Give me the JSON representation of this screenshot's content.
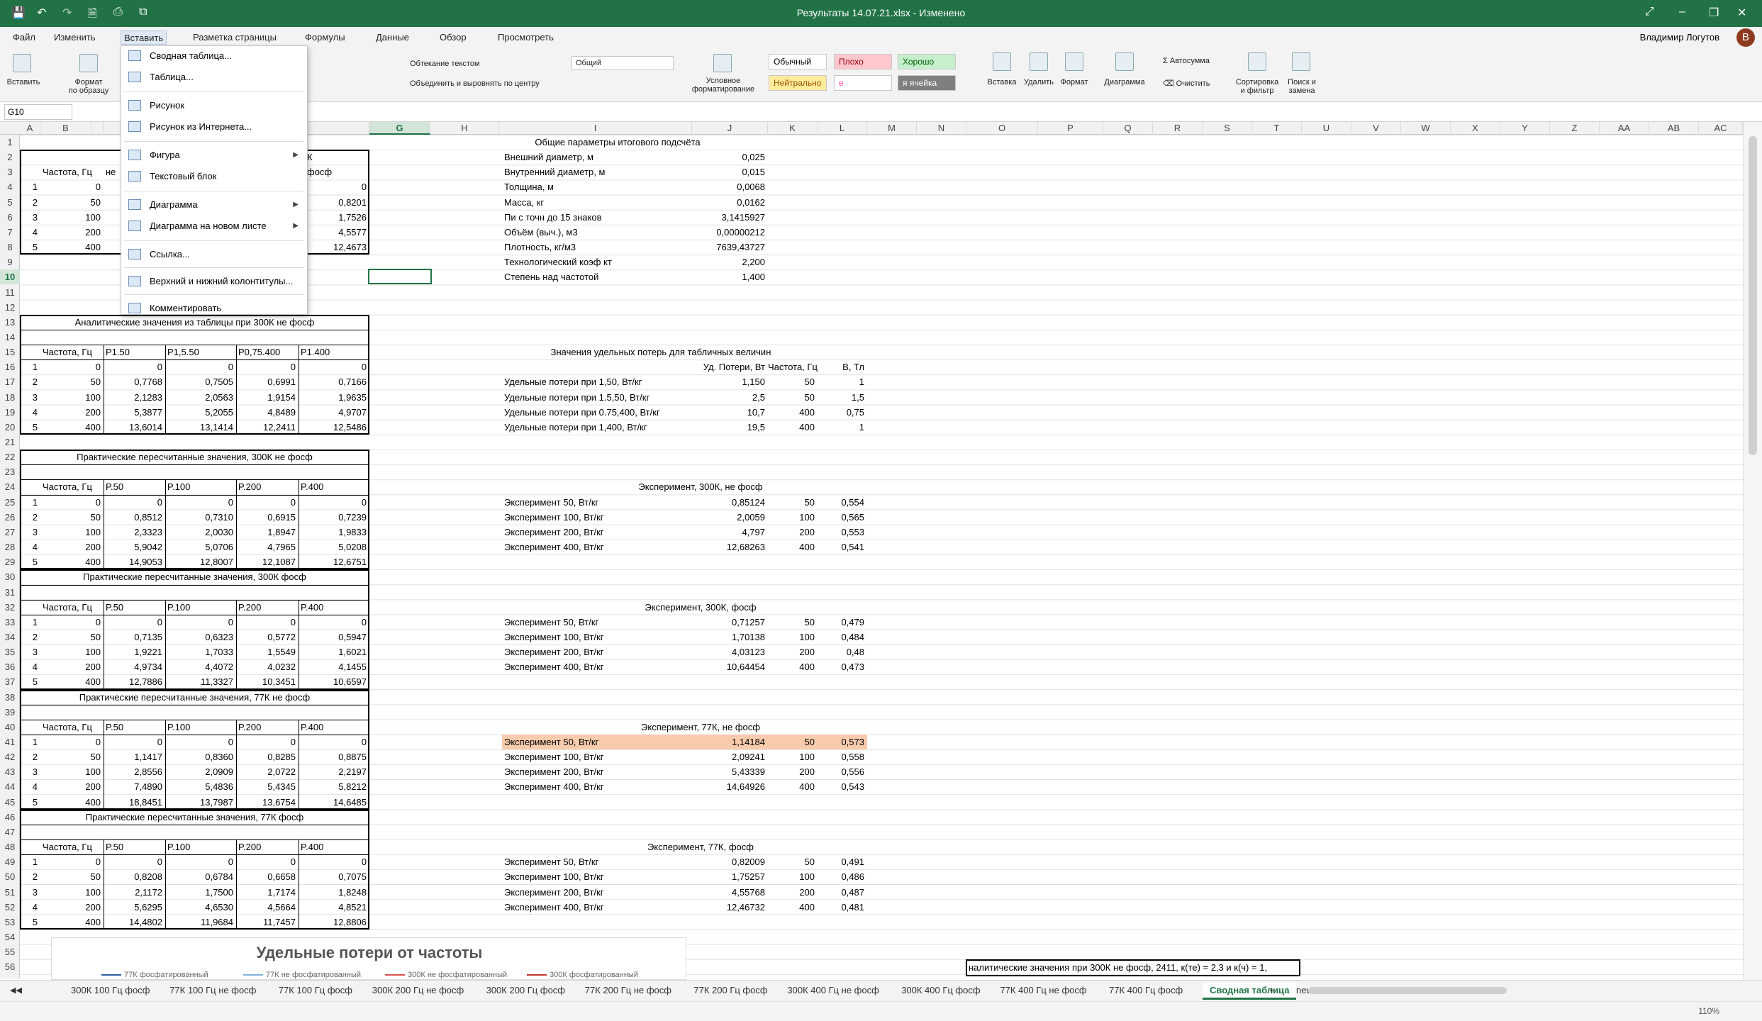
{
  "window": {
    "title": "Результаты 14.07.21.xlsx - Изменено"
  },
  "menu": [
    "Файл",
    "Изменить",
    "Вставить",
    "Разметка страницы",
    "Формулы",
    "Данные",
    "Обзор",
    "Просмотреть"
  ],
  "user": "Владимир Логутов",
  "avatar": "В",
  "ribbon": {
    "paste": "Вставить",
    "format_painter": "Формат\nпо образцу",
    "wrap": "Обтекание текстом",
    "merge": "Объединить и выровнять по центру",
    "number_format": "Общий",
    "cond_format": "Условное\nформатирование",
    "styles": [
      "Обычный",
      "Плохо",
      "Хорошо",
      "Нейтрально",
      "е",
      "я ячейка"
    ],
    "insert": "Вставка",
    "delete": "Удалить",
    "format": "Формат",
    "chart": "Диаграмма",
    "autosum": "Автосумма",
    "clear": "Очистить",
    "sort": "Сортировка\nи фильтр",
    "find": "Поиск и\nзамена"
  },
  "namebox": "G10",
  "dropdown": [
    {
      "label": "Сводная таблица...",
      "arrow": false
    },
    {
      "label": "Таблица...",
      "arrow": false
    },
    {
      "label": "Рисунок",
      "arrow": false
    },
    {
      "label": "Рисунок из Интернета...",
      "arrow": false
    },
    {
      "label": "Фигура",
      "arrow": true
    },
    {
      "label": "Текстовый блок",
      "arrow": false
    },
    {
      "label": "Диаграмма",
      "arrow": true
    },
    {
      "label": "Диаграмма на новом листе",
      "arrow": true
    },
    {
      "label": "Ссылка...",
      "arrow": false
    },
    {
      "label": "Верхний и нижний колонтитулы...",
      "arrow": false
    },
    {
      "label": "Комментировать",
      "arrow": false
    }
  ],
  "columns": [
    "A",
    "B",
    "",
    "",
    "",
    "F",
    "G",
    "H",
    "I",
    "J",
    "K",
    "L",
    "M",
    "N",
    "O",
    "P",
    "Q",
    "R",
    "S",
    "T",
    "U",
    "V",
    "W",
    "X",
    "Y",
    "Z",
    "AA",
    "AB",
    "AC"
  ],
  "sheet": {
    "top_frag": {
      "b3": "Частота, Гц",
      "c3": "не",
      "f2": "К",
      "f3": "фосф",
      "rows": [
        [
          "1",
          "0",
          "0"
        ],
        [
          "2",
          "50",
          "0,8201"
        ],
        [
          "3",
          "100",
          "1,7526"
        ],
        [
          "4",
          "200",
          "4,5577"
        ],
        [
          "5",
          "400",
          "12,4673"
        ]
      ]
    },
    "blocks": [
      {
        "title": "Аналитические значения из таблицы при 300К не фосф",
        "hdr": [
          "Частота, Гц",
          "P1.50",
          "P1,5.50",
          "P0,75.400",
          "P1.400"
        ],
        "rows": [
          [
            "1",
            "0",
            "0",
            "0",
            "0",
            "0"
          ],
          [
            "2",
            "50",
            "0,7768",
            "0,7505",
            "0,6991",
            "0,7166"
          ],
          [
            "3",
            "100",
            "2,1283",
            "2,0563",
            "1,9154",
            "1,9635"
          ],
          [
            "4",
            "200",
            "5,3877",
            "5,2055",
            "4,8489",
            "4,9707"
          ],
          [
            "5",
            "400",
            "13,6014",
            "13,1414",
            "12,2411",
            "12,5486"
          ]
        ]
      },
      {
        "title": "Практические пересчитанные значения, 300К не фосф",
        "hdr": [
          "Частота, Гц",
          "P.50",
          "P.100",
          "P.200",
          "P.400"
        ],
        "rows": [
          [
            "1",
            "0",
            "0",
            "0",
            "0",
            "0"
          ],
          [
            "2",
            "50",
            "0,8512",
            "0,7310",
            "0,6915",
            "0,7239"
          ],
          [
            "3",
            "100",
            "2,3323",
            "2,0030",
            "1,8947",
            "1,9833"
          ],
          [
            "4",
            "200",
            "5,9042",
            "5,0706",
            "4,7965",
            "5,0208"
          ],
          [
            "5",
            "400",
            "14,9053",
            "12,8007",
            "12,1087",
            "12,6751"
          ]
        ]
      },
      {
        "title": "Практические пересчитанные значения, 300К фосф",
        "hdr": [
          "Частота, Гц",
          "P.50",
          "P.100",
          "P.200",
          "P.400"
        ],
        "rows": [
          [
            "1",
            "0",
            "0",
            "0",
            "0",
            "0"
          ],
          [
            "2",
            "50",
            "0,7135",
            "0,6323",
            "0,5772",
            "0,5947"
          ],
          [
            "3",
            "100",
            "1,9221",
            "1,7033",
            "1,5549",
            "1,6021"
          ],
          [
            "4",
            "200",
            "4,9734",
            "4,4072",
            "4,0232",
            "4,1455"
          ],
          [
            "5",
            "400",
            "12,7886",
            "11,3327",
            "10,3451",
            "10,6597"
          ]
        ]
      },
      {
        "title": "Практические пересчитанные значения, 77К не фосф",
        "hdr": [
          "Частота, Гц",
          "P.50",
          "P.100",
          "P.200",
          "P.400"
        ],
        "rows": [
          [
            "1",
            "0",
            "0",
            "0",
            "0",
            "0"
          ],
          [
            "2",
            "50",
            "1,1417",
            "0,8360",
            "0,8285",
            "0,8875"
          ],
          [
            "3",
            "100",
            "2,8556",
            "2,0909",
            "2,0722",
            "2,2197"
          ],
          [
            "4",
            "200",
            "7,4890",
            "5,4836",
            "5,4345",
            "5,8212"
          ],
          [
            "5",
            "400",
            "18,8451",
            "13,7987",
            "13,6754",
            "14,6485"
          ]
        ]
      },
      {
        "title": "Практические пересчитанные значения, 77К фосф",
        "hdr": [
          "Частота, Гц",
          "P.50",
          "P.100",
          "P.200",
          "P.400"
        ],
        "rows": [
          [
            "1",
            "0",
            "0",
            "0",
            "0",
            "0"
          ],
          [
            "2",
            "50",
            "0,8208",
            "0,6784",
            "0,6658",
            "0,7075"
          ],
          [
            "3",
            "100",
            "2,1172",
            "1,7500",
            "1,7174",
            "1,8248"
          ],
          [
            "4",
            "200",
            "5,6295",
            "4,6530",
            "4,5664",
            "4,8521"
          ],
          [
            "5",
            "400",
            "14,4802",
            "11,9684",
            "11,7457",
            "12,8806"
          ]
        ]
      }
    ],
    "params": {
      "title": "Общие параметры итогового подсчёта",
      "rows": [
        [
          "Внешний диаметр, м",
          "0,025"
        ],
        [
          "Внутренний диаметр, м",
          "0,015"
        ],
        [
          "Толщина, м",
          "0,0068"
        ],
        [
          "Масса, кг",
          "0,0162"
        ],
        [
          "Пи с точн до 15 знаков",
          "3,1415927"
        ],
        [
          "Объём (выч.), м3",
          "0,00000212"
        ],
        [
          "Плотность, кг/м3",
          "7639,43727"
        ],
        [
          "Технологический коэф кт",
          "2,200"
        ],
        [
          "Степень над частотой",
          "1,400"
        ]
      ]
    },
    "losses": {
      "title": "Значения удельных потерь для табличных величин",
      "hdr": [
        "Уд. Потери, Вт",
        "Частота, Гц",
        "В, Тл"
      ],
      "rows": [
        [
          "Удельные потери при 1,50, Вт/кг",
          "1,150",
          "50",
          "1"
        ],
        [
          "Удельные потери при 1.5,50, Вт/кг",
          "2,5",
          "50",
          "1,5"
        ],
        [
          "Удельные потери при 0.75,400, Вт/кг",
          "10,7",
          "400",
          "0,75"
        ],
        [
          "Удельные потери при 1,400, Вт/кг",
          "19,5",
          "400",
          "1"
        ]
      ]
    },
    "experiments": [
      {
        "title": "Эксперимент, 300К, не фосф",
        "rows": [
          [
            "Эксперимент 50, Вт/кг",
            "0,85124",
            "50",
            "0,554"
          ],
          [
            "Эксперимент 100, Вт/кг",
            "2,0059",
            "100",
            "0,565"
          ],
          [
            "Эксперимент 200, Вт/кг",
            "4,797",
            "200",
            "0,553"
          ],
          [
            "Эксперимент 400, Вт/кг",
            "12,68263",
            "400",
            "0,541"
          ]
        ]
      },
      {
        "title": "Эксперимент, 300К, фосф",
        "rows": [
          [
            "Эксперимент 50, Вт/кг",
            "0,71257",
            "50",
            "0,479"
          ],
          [
            "Эксперимент 100, Вт/кг",
            "1,70138",
            "100",
            "0,484"
          ],
          [
            "Эксперимент 200, Вт/кг",
            "4,03123",
            "200",
            "0,48"
          ],
          [
            "Эксперимент 400, Вт/кг",
            "10,64454",
            "400",
            "0,473"
          ]
        ]
      },
      {
        "title": "Эксперимент, 77К, не фосф",
        "rows": [
          [
            "Эксперимент 50, Вт/кг",
            "1,14184",
            "50",
            "0,573"
          ],
          [
            "Эксперимент 100, Вт/кг",
            "2,09241",
            "100",
            "0,558"
          ],
          [
            "Эксперимент 200, Вт/кг",
            "5,43339",
            "200",
            "0,556"
          ],
          [
            "Эксперимент 400, Вт/кг",
            "14,64926",
            "400",
            "0,543"
          ]
        ]
      },
      {
        "title": "Эксперимент, 77К, фосф",
        "rows": [
          [
            "Эксперимент 50, Вт/кг",
            "0,82009",
            "50",
            "0,491"
          ],
          [
            "Эксперимент 100, Вт/кг",
            "1,75257",
            "100",
            "0,486"
          ],
          [
            "Эксперимент 200, Вт/кг",
            "4,55768",
            "200",
            "0,487"
          ],
          [
            "Эксперимент 400, Вт/кг",
            "12,46732",
            "400",
            "0,481"
          ]
        ]
      }
    ],
    "chart_title": "Удельные потери от частоты",
    "legend": [
      "77К фосфатированный",
      "77К не фосфатированный",
      "300К не фосфатированный",
      "300К фосфатированный"
    ],
    "legend_colors": [
      "#2e5fa3",
      "#7fb3d9",
      "#d9534f",
      "#c0392b"
    ],
    "partial_box": "налитические значения при 300К не фосф, 2411, к(те) = 2,3 и к(ч) = 1,"
  },
  "tabs": [
    "300К 100 Гц фосф",
    "77К 100 Гц не фосф",
    "77К 100 Гц фосф",
    "300К 200 Гц не фосф",
    "300К 200 Гц фосф",
    "77К 200 Гц не фосф",
    "77К 200 Гц фосф",
    "300К 400 Гц не фосф",
    "300К 400 Гц фосф",
    "77К 400 Гц не фосф",
    "77К 400 Гц фосф",
    "Сводная таблица",
    "new"
  ],
  "active_tab": "Сводная таблица",
  "zoom": "110%"
}
